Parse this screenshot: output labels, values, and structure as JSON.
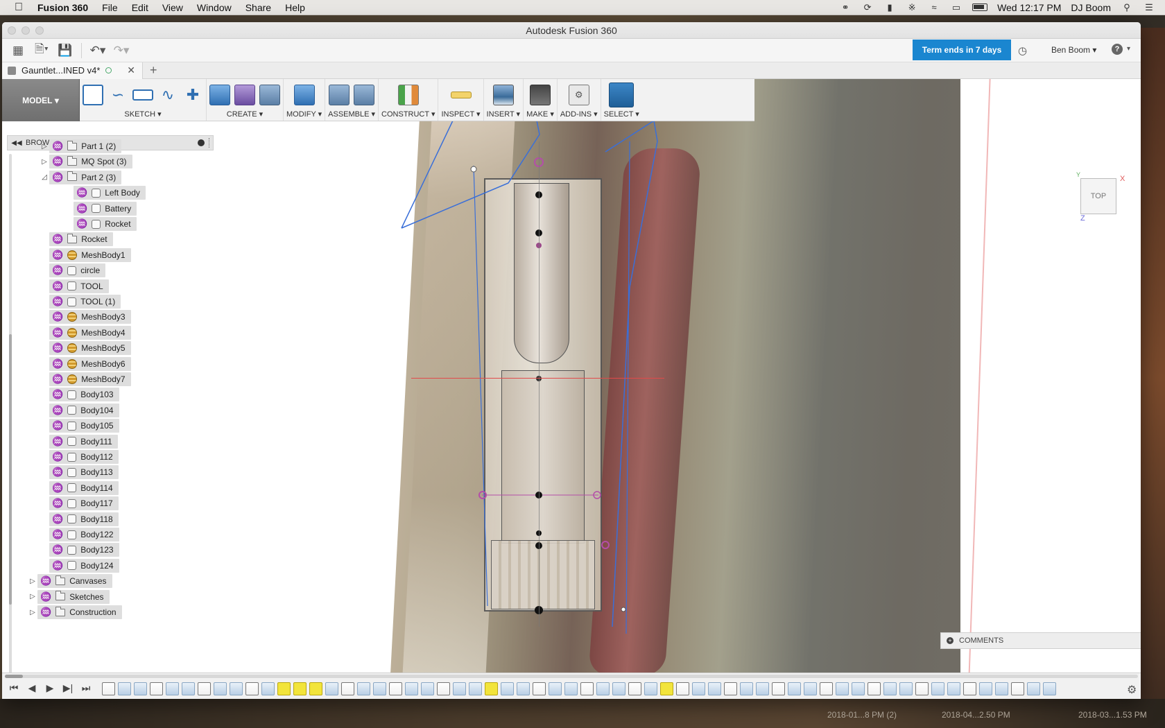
{
  "menubar": {
    "app_name": "Fusion 360",
    "items": [
      "File",
      "Edit",
      "View",
      "Window",
      "Share",
      "Help"
    ],
    "clock": "Wed 12:17 PM",
    "user": "DJ Boom"
  },
  "window": {
    "title": "Autodesk Fusion 360"
  },
  "toolbar": {
    "term_badge": "Term ends in 7 days",
    "user": "Ben Boom"
  },
  "document_tab": {
    "label": "Gauntlet...INED v4*"
  },
  "ribbon": {
    "mode": "MODEL",
    "groups": [
      {
        "label": "SKETCH"
      },
      {
        "label": "CREATE"
      },
      {
        "label": "MODIFY"
      },
      {
        "label": "ASSEMBLE"
      },
      {
        "label": "CONSTRUCT"
      },
      {
        "label": "INSPECT"
      },
      {
        "label": "INSERT"
      },
      {
        "label": "MAKE"
      },
      {
        "label": "ADD-INS"
      },
      {
        "label": "SELECT"
      }
    ]
  },
  "browser": {
    "title": "BROWSER",
    "items": [
      {
        "label": "Part 1 (2)",
        "icon": "folder",
        "visible": true,
        "expander": "collapsed"
      },
      {
        "label": "MQ Spot (3)",
        "icon": "folder",
        "visible": true,
        "expander": "collapsed"
      },
      {
        "label": "Part 2 (3)",
        "icon": "folder",
        "visible": true,
        "expander": "expanded"
      },
      {
        "label": "Left Body",
        "icon": "body",
        "visible": true,
        "expander": "none"
      },
      {
        "label": "Battery",
        "icon": "body",
        "visible": false,
        "expander": "none"
      },
      {
        "label": "Rocket",
        "icon": "body",
        "visible": true,
        "expander": "none"
      },
      {
        "label": "Rocket",
        "icon": "folder",
        "visible": false,
        "expander": "none"
      },
      {
        "label": "MeshBody1",
        "icon": "mesh",
        "visible": false,
        "expander": "none"
      },
      {
        "label": "circle",
        "icon": "body",
        "visible": false,
        "expander": "none"
      },
      {
        "label": "TOOL",
        "icon": "body",
        "visible": false,
        "expander": "none"
      },
      {
        "label": "TOOL (1)",
        "icon": "body",
        "visible": false,
        "expander": "none"
      },
      {
        "label": "MeshBody3",
        "icon": "mesh",
        "visible": false,
        "expander": "none"
      },
      {
        "label": "MeshBody4",
        "icon": "mesh",
        "visible": false,
        "expander": "none"
      },
      {
        "label": "MeshBody5",
        "icon": "mesh",
        "visible": false,
        "expander": "none"
      },
      {
        "label": "MeshBody6",
        "icon": "mesh",
        "visible": false,
        "expander": "none"
      },
      {
        "label": "MeshBody7",
        "icon": "mesh",
        "visible": false,
        "expander": "none"
      },
      {
        "label": "Body103",
        "icon": "body",
        "visible": false,
        "expander": "none"
      },
      {
        "label": "Body104",
        "icon": "body",
        "visible": false,
        "expander": "none"
      },
      {
        "label": "Body105",
        "icon": "body",
        "visible": false,
        "expander": "none"
      },
      {
        "label": "Body111",
        "icon": "body",
        "visible": false,
        "expander": "none"
      },
      {
        "label": "Body112",
        "icon": "body",
        "visible": true,
        "expander": "none"
      },
      {
        "label": "Body113",
        "icon": "body",
        "visible": false,
        "expander": "none"
      },
      {
        "label": "Body114",
        "icon": "body",
        "visible": false,
        "expander": "none"
      },
      {
        "label": "Body117",
        "icon": "body",
        "visible": true,
        "expander": "none"
      },
      {
        "label": "Body118",
        "icon": "body",
        "visible": false,
        "expander": "none"
      },
      {
        "label": "Body122",
        "icon": "body",
        "visible": false,
        "expander": "none"
      },
      {
        "label": "Body123",
        "icon": "body",
        "visible": false,
        "expander": "none"
      },
      {
        "label": "Body124",
        "icon": "body",
        "visible": false,
        "expander": "none"
      },
      {
        "label": "Canvases",
        "icon": "folder",
        "visible": true,
        "expander": "collapsed"
      },
      {
        "label": "Sketches",
        "icon": "folder",
        "visible": true,
        "expander": "collapsed"
      },
      {
        "label": "Construction",
        "icon": "folder",
        "visible": true,
        "expander": "collapsed"
      }
    ]
  },
  "viewcube": {
    "face": "TOP",
    "x": "X",
    "y": "Y",
    "z": "Z"
  },
  "comments": {
    "label": "COMMENTS"
  },
  "desktop_files": [
    "2018-01...8 PM (2)",
    "2018-04...2.50 PM",
    "2018-03...1.53 PM"
  ],
  "colors": {
    "term_badge": "#1a86d0",
    "bulb_on": "#e8b924",
    "timeline_highlight": "#f2e43b"
  }
}
